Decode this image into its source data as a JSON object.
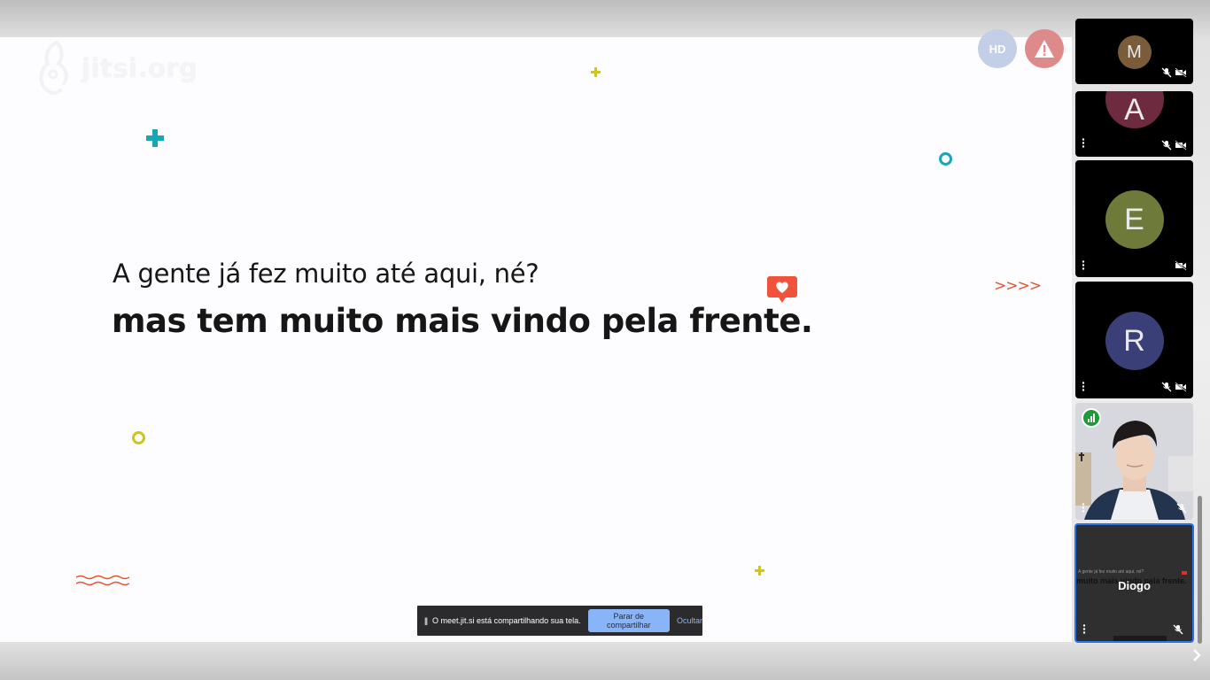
{
  "slide": {
    "logo_text": "jitsi.org",
    "headline_line1": "A gente já fez muito até aqui, né?",
    "headline_line2": "mas tem muito mais vindo pela frente.",
    "chevrons": ">>>>"
  },
  "stage_badges": {
    "quality_label": "HD"
  },
  "share_notification": {
    "message": "O meet.jit.si está compartilhando sua tela.",
    "stop_label": "Parar de compartilhar",
    "hide_label": "Ocultar"
  },
  "participants": [
    {
      "initial": "M",
      "avatar_color": "#7a5b3a",
      "mic_muted": true,
      "camera_off": true
    },
    {
      "initial": "A",
      "avatar_color": "#6e2b40",
      "mic_muted": true,
      "camera_off": true
    },
    {
      "initial": "E",
      "avatar_color": "#6e7a3a",
      "mic_muted": false,
      "camera_off": true
    },
    {
      "initial": "R",
      "avatar_color": "#3b3f78",
      "mic_muted": true,
      "camera_off": true
    }
  ],
  "local_screen_tile": {
    "name": "Diogo",
    "preview_text": "muito mais vindo pela frente."
  },
  "colors": {
    "accent_teal": "#1aa6b4",
    "accent_yellow": "#cbc71b",
    "accent_orange": "#e6532f",
    "stop_button": "#8ab4f8",
    "active_tile_border": "#2b72e8"
  }
}
